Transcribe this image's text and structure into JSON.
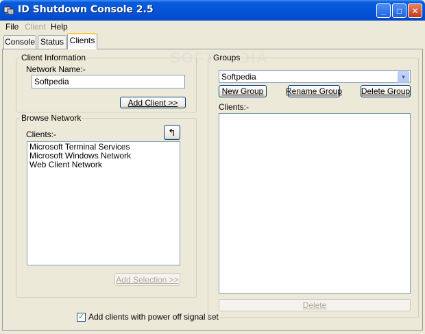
{
  "window": {
    "title": "ID Shutdown Console 2.5",
    "minimize": "_",
    "maximize": "□",
    "close": "✕"
  },
  "menu": [
    {
      "label": "File",
      "enabled": true
    },
    {
      "label": "Client",
      "enabled": false
    },
    {
      "label": "Help",
      "enabled": true
    }
  ],
  "tabs": [
    {
      "label": "Console",
      "active": false
    },
    {
      "label": "Status",
      "active": false
    },
    {
      "label": "Clients",
      "active": true
    }
  ],
  "client_info": {
    "group_label": "Client Information",
    "network_name_label": "Network Name:-",
    "network_name_value": "Softpedia",
    "add_client_button": "Add Client >>"
  },
  "browse_network": {
    "group_label": "Browse Network",
    "clients_label": "Clients:-",
    "up_glyph": "↰",
    "items": [
      "Microsoft Terminal Services",
      "Microsoft Windows Network",
      "Web Client Network"
    ],
    "add_selection_button": "Add Selection >>"
  },
  "groups": {
    "group_label": "Groups",
    "selected_group": "Softpedia",
    "new_group_button": "New Group",
    "rename_group_button": "Rename Group",
    "delete_group_button": "Delete Group",
    "clients_label": "Clients:-",
    "delete_button": "Delete"
  },
  "options": {
    "power_off_label": "Add clients with power off signal set",
    "power_off_checked": true,
    "check_glyph": "✓"
  },
  "watermark": "SOFTPEDIA",
  "accent_colors": {
    "titlebar": "#0554d8",
    "tab_highlight": "#ffc83c"
  }
}
